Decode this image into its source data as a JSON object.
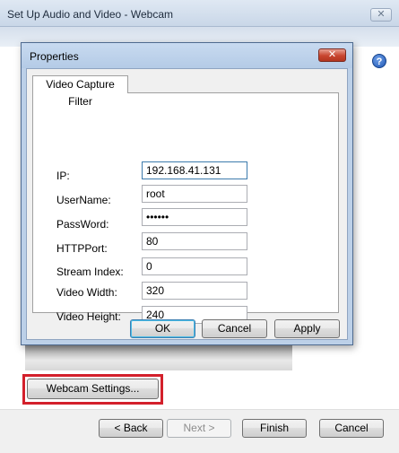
{
  "wizard": {
    "title": "Set Up Audio and Video - Webcam",
    "close_glyph": "✕",
    "help_glyph": "?",
    "webcam_settings_label": "Webcam Settings...",
    "back_label": "< Back",
    "next_label": "Next >",
    "finish_label": "Finish",
    "cancel_label": "Cancel"
  },
  "properties_dialog": {
    "title": "Properties",
    "close_glyph": "✕",
    "tab_label": "Video Capture Filter",
    "fields": {
      "ip": {
        "label": "IP:",
        "value": "192.168.41.131"
      },
      "username": {
        "label": "UserName:",
        "value": "root"
      },
      "password": {
        "label": "PassWord:",
        "value": "••••••"
      },
      "httpport": {
        "label": "HTTPPort:",
        "value": "80"
      },
      "stream_index": {
        "label": "Stream Index:",
        "value": "0"
      },
      "video_width": {
        "label": "Video Width:",
        "value": "320"
      },
      "video_height": {
        "label": "Video Height:",
        "value": "240"
      }
    },
    "ok_label": "OK",
    "cancel_label": "Cancel",
    "apply_label": "Apply"
  },
  "colors": {
    "highlight_box": "#d3202b",
    "dialog_frame": "#bcd0e8",
    "close_button": "#c8452f"
  },
  "icons": {
    "help": "help-icon",
    "close": "close-icon"
  }
}
